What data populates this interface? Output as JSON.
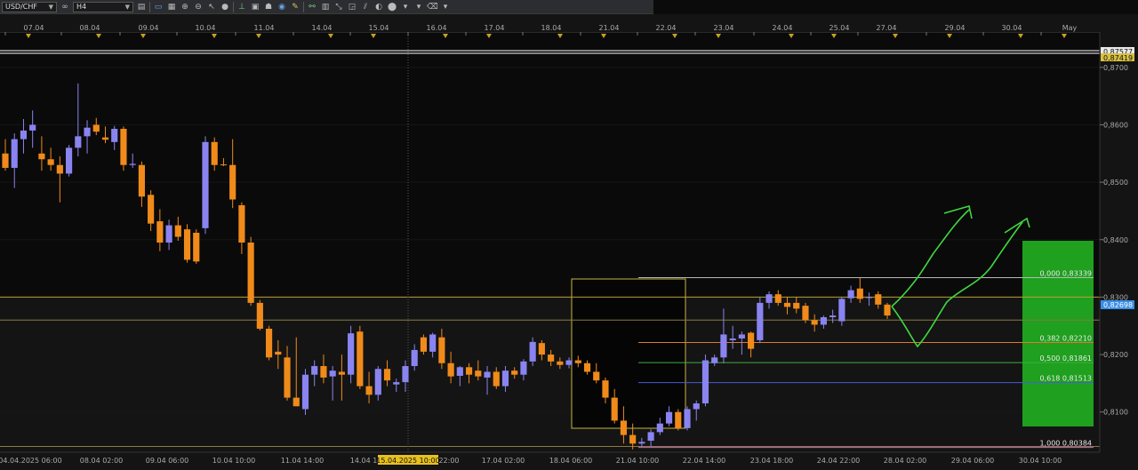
{
  "toolbar": {
    "symbol": "USD/CHF",
    "timeframe": "H4",
    "icons": [
      "chart-type-icon",
      "link-icon",
      "crosshair-icon",
      "zoom-in-icon",
      "zoom-out-icon",
      "cursor-icon",
      "point-icon",
      "trendline-icon",
      "text-icon",
      "object-icon",
      "screenshot-icon",
      "pencil-icon",
      "indicator-icon",
      "template-icon",
      "fibonacci-icon",
      "rectangle-icon",
      "channel-icon",
      "ellipse-icon",
      "line-icon",
      "eraser-icon"
    ]
  },
  "chart_data": {
    "type": "candlestick",
    "symbol": "USD/CHF",
    "timeframe": "H4",
    "y_range": [
      0.803,
      0.876
    ],
    "price_ticks": [
      "0,8700",
      "0,8600",
      "0,8500",
      "0,8400",
      "0,8300",
      "0,8200",
      "0,8100"
    ],
    "top_labels": [
      "07.04",
      "08.04",
      "09.04",
      "10.04",
      "11.04",
      "14.04",
      "15.04",
      "16.04",
      "17.04",
      "18.04",
      "21.04",
      "22.04",
      "23.04",
      "24.04",
      "25.04",
      "27.04",
      "29.04",
      "30.04",
      "May"
    ],
    "bottom_labels": [
      "04.04.2025 06:00",
      "08.04 02:00",
      "09.04 06:00",
      "10.04 10:00",
      "11.04 14:00",
      "14.04 18:00",
      "15.04.2025 10:00",
      "22:00",
      "17.04 02:00",
      "18.04 06:00",
      "21.04 10:00",
      "22.04 14:00",
      "23.04 18:00",
      "24.04 22:00",
      "28.04 02:00",
      "29.04 06:00",
      "30.04 10:00"
    ],
    "current_price": "0,82698",
    "top_price_labels": [
      "0,87577",
      "0,87419"
    ],
    "horizontal_levels": [
      0.83,
      0.826,
      0.804
    ],
    "fibonacci": [
      {
        "ratio": 0.0,
        "label": "0,000 0,83339",
        "price": 0.83339,
        "color": "#b8b8b8"
      },
      {
        "ratio": 0.382,
        "label": "0,382 0,82210",
        "price": 0.8221,
        "color": "#e07a2a"
      },
      {
        "ratio": 0.5,
        "label": "0,500 0,81861",
        "price": 0.81861,
        "color": "#3fae3f"
      },
      {
        "ratio": 0.618,
        "label": "0,618 0,81513",
        "price": 0.81513,
        "color": "#4a5bd6"
      },
      {
        "ratio": 1.0,
        "label": "1,000 0,80384",
        "price": 0.80384,
        "color": "#c070c0"
      }
    ],
    "candles": [
      {
        "o": 0.855,
        "h": 0.8575,
        "l": 0.852,
        "c": 0.8525
      },
      {
        "o": 0.8525,
        "h": 0.8585,
        "l": 0.849,
        "c": 0.8575
      },
      {
        "o": 0.8575,
        "h": 0.861,
        "l": 0.855,
        "c": 0.859
      },
      {
        "o": 0.859,
        "h": 0.8625,
        "l": 0.856,
        "c": 0.86
      },
      {
        "o": 0.855,
        "h": 0.858,
        "l": 0.852,
        "c": 0.854
      },
      {
        "o": 0.854,
        "h": 0.856,
        "l": 0.852,
        "c": 0.853
      },
      {
        "o": 0.853,
        "h": 0.8545,
        "l": 0.8465,
        "c": 0.8515
      },
      {
        "o": 0.8515,
        "h": 0.8565,
        "l": 0.851,
        "c": 0.856
      },
      {
        "o": 0.856,
        "h": 0.8672,
        "l": 0.8545,
        "c": 0.858
      },
      {
        "o": 0.858,
        "h": 0.8608,
        "l": 0.855,
        "c": 0.8595
      },
      {
        "o": 0.86,
        "h": 0.8612,
        "l": 0.8582,
        "c": 0.8588
      },
      {
        "o": 0.8578,
        "h": 0.8597,
        "l": 0.8568,
        "c": 0.8574
      },
      {
        "o": 0.857,
        "h": 0.8598,
        "l": 0.8556,
        "c": 0.8593
      },
      {
        "o": 0.8593,
        "h": 0.8597,
        "l": 0.852,
        "c": 0.853
      },
      {
        "o": 0.853,
        "h": 0.855,
        "l": 0.8525,
        "c": 0.8532
      },
      {
        "o": 0.853,
        "h": 0.8536,
        "l": 0.8457,
        "c": 0.8475
      },
      {
        "o": 0.8478,
        "h": 0.8486,
        "l": 0.8415,
        "c": 0.8428
      },
      {
        "o": 0.8432,
        "h": 0.8453,
        "l": 0.838,
        "c": 0.8395
      },
      {
        "o": 0.8395,
        "h": 0.8435,
        "l": 0.8382,
        "c": 0.8425
      },
      {
        "o": 0.8425,
        "h": 0.844,
        "l": 0.8398,
        "c": 0.8405
      },
      {
        "o": 0.8418,
        "h": 0.8427,
        "l": 0.836,
        "c": 0.8365
      },
      {
        "o": 0.8412,
        "h": 0.8418,
        "l": 0.8358,
        "c": 0.8362
      },
      {
        "o": 0.842,
        "h": 0.858,
        "l": 0.841,
        "c": 0.857
      },
      {
        "o": 0.857,
        "h": 0.8578,
        "l": 0.852,
        "c": 0.853
      },
      {
        "o": 0.8531,
        "h": 0.8542,
        "l": 0.8528,
        "c": 0.853
      },
      {
        "o": 0.853,
        "h": 0.8575,
        "l": 0.8455,
        "c": 0.847
      },
      {
        "o": 0.846,
        "h": 0.8465,
        "l": 0.8375,
        "c": 0.8395
      },
      {
        "o": 0.8395,
        "h": 0.8405,
        "l": 0.8285,
        "c": 0.829
      },
      {
        "o": 0.829,
        "h": 0.8295,
        "l": 0.8242,
        "c": 0.8245
      },
      {
        "o": 0.8245,
        "h": 0.825,
        "l": 0.819,
        "c": 0.8195
      },
      {
        "o": 0.8205,
        "h": 0.8225,
        "l": 0.8175,
        "c": 0.82
      },
      {
        "o": 0.8195,
        "h": 0.8215,
        "l": 0.812,
        "c": 0.8125
      },
      {
        "o": 0.8125,
        "h": 0.823,
        "l": 0.811,
        "c": 0.811
      },
      {
        "o": 0.8105,
        "h": 0.8175,
        "l": 0.8095,
        "c": 0.8165
      },
      {
        "o": 0.8165,
        "h": 0.819,
        "l": 0.8145,
        "c": 0.818
      },
      {
        "o": 0.818,
        "h": 0.82,
        "l": 0.815,
        "c": 0.816
      },
      {
        "o": 0.8162,
        "h": 0.818,
        "l": 0.812,
        "c": 0.8172
      },
      {
        "o": 0.817,
        "h": 0.82,
        "l": 0.812,
        "c": 0.8165
      },
      {
        "o": 0.8165,
        "h": 0.825,
        "l": 0.815,
        "c": 0.8237
      },
      {
        "o": 0.824,
        "h": 0.825,
        "l": 0.814,
        "c": 0.8145
      },
      {
        "o": 0.8145,
        "h": 0.817,
        "l": 0.8115,
        "c": 0.813
      },
      {
        "o": 0.813,
        "h": 0.818,
        "l": 0.812,
        "c": 0.8175
      },
      {
        "o": 0.8175,
        "h": 0.819,
        "l": 0.8145,
        "c": 0.8155
      },
      {
        "o": 0.8148,
        "h": 0.8158,
        "l": 0.8135,
        "c": 0.8152
      },
      {
        "o": 0.8152,
        "h": 0.819,
        "l": 0.8135,
        "c": 0.818
      },
      {
        "o": 0.818,
        "h": 0.8218,
        "l": 0.8172,
        "c": 0.8208
      },
      {
        "o": 0.823,
        "h": 0.8235,
        "l": 0.82,
        "c": 0.8205
      },
      {
        "o": 0.8205,
        "h": 0.8238,
        "l": 0.8195,
        "c": 0.8235
      },
      {
        "o": 0.823,
        "h": 0.8245,
        "l": 0.8175,
        "c": 0.8185
      },
      {
        "o": 0.8185,
        "h": 0.8205,
        "l": 0.815,
        "c": 0.8162
      },
      {
        "o": 0.8163,
        "h": 0.818,
        "l": 0.8145,
        "c": 0.8178
      },
      {
        "o": 0.8178,
        "h": 0.8185,
        "l": 0.815,
        "c": 0.8165
      },
      {
        "o": 0.8172,
        "h": 0.819,
        "l": 0.8155,
        "c": 0.8162
      },
      {
        "o": 0.816,
        "h": 0.818,
        "l": 0.813,
        "c": 0.817
      },
      {
        "o": 0.817,
        "h": 0.8178,
        "l": 0.814,
        "c": 0.8145
      },
      {
        "o": 0.8145,
        "h": 0.818,
        "l": 0.8135,
        "c": 0.8172
      },
      {
        "o": 0.8172,
        "h": 0.8178,
        "l": 0.8158,
        "c": 0.8165
      },
      {
        "o": 0.8165,
        "h": 0.8192,
        "l": 0.8155,
        "c": 0.8188
      },
      {
        "o": 0.8188,
        "h": 0.823,
        "l": 0.818,
        "c": 0.8222
      },
      {
        "o": 0.822,
        "h": 0.8225,
        "l": 0.819,
        "c": 0.82
      },
      {
        "o": 0.82,
        "h": 0.8208,
        "l": 0.818,
        "c": 0.8188
      },
      {
        "o": 0.8188,
        "h": 0.8195,
        "l": 0.8175,
        "c": 0.8182
      },
      {
        "o": 0.8182,
        "h": 0.8195,
        "l": 0.8176,
        "c": 0.819
      },
      {
        "o": 0.819,
        "h": 0.8198,
        "l": 0.8178,
        "c": 0.8185
      },
      {
        "o": 0.8185,
        "h": 0.819,
        "l": 0.8165,
        "c": 0.817
      },
      {
        "o": 0.817,
        "h": 0.8185,
        "l": 0.815,
        "c": 0.8155
      },
      {
        "o": 0.8155,
        "h": 0.816,
        "l": 0.8115,
        "c": 0.8125
      },
      {
        "o": 0.8125,
        "h": 0.814,
        "l": 0.808,
        "c": 0.8085
      },
      {
        "o": 0.8085,
        "h": 0.811,
        "l": 0.8045,
        "c": 0.806
      },
      {
        "o": 0.806,
        "h": 0.808,
        "l": 0.8035,
        "c": 0.8045
      },
      {
        "o": 0.8045,
        "h": 0.8055,
        "l": 0.804,
        "c": 0.8048
      },
      {
        "o": 0.805,
        "h": 0.807,
        "l": 0.804,
        "c": 0.8065
      },
      {
        "o": 0.8065,
        "h": 0.809,
        "l": 0.806,
        "c": 0.808
      },
      {
        "o": 0.808,
        "h": 0.811,
        "l": 0.8075,
        "c": 0.81
      },
      {
        "o": 0.81,
        "h": 0.8105,
        "l": 0.8068,
        "c": 0.8072
      },
      {
        "o": 0.8072,
        "h": 0.811,
        "l": 0.8068,
        "c": 0.8105
      },
      {
        "o": 0.8105,
        "h": 0.812,
        "l": 0.8085,
        "c": 0.8115
      },
      {
        "o": 0.8115,
        "h": 0.82,
        "l": 0.811,
        "c": 0.819
      },
      {
        "o": 0.8185,
        "h": 0.82,
        "l": 0.818,
        "c": 0.8195
      },
      {
        "o": 0.8195,
        "h": 0.828,
        "l": 0.8185,
        "c": 0.8235
      },
      {
        "o": 0.8225,
        "h": 0.825,
        "l": 0.821,
        "c": 0.8228
      },
      {
        "o": 0.8228,
        "h": 0.824,
        "l": 0.82,
        "c": 0.8235
      },
      {
        "o": 0.8238,
        "h": 0.824,
        "l": 0.8195,
        "c": 0.821
      },
      {
        "o": 0.8225,
        "h": 0.83,
        "l": 0.822,
        "c": 0.829
      },
      {
        "o": 0.829,
        "h": 0.831,
        "l": 0.828,
        "c": 0.8305
      },
      {
        "o": 0.8305,
        "h": 0.8312,
        "l": 0.8285,
        "c": 0.829
      },
      {
        "o": 0.829,
        "h": 0.83,
        "l": 0.827,
        "c": 0.8283
      },
      {
        "o": 0.829,
        "h": 0.83,
        "l": 0.8272,
        "c": 0.828
      },
      {
        "o": 0.8285,
        "h": 0.829,
        "l": 0.8255,
        "c": 0.826
      },
      {
        "o": 0.826,
        "h": 0.827,
        "l": 0.824,
        "c": 0.8252
      },
      {
        "o": 0.8252,
        "h": 0.8268,
        "l": 0.8245,
        "c": 0.8265
      },
      {
        "o": 0.8265,
        "h": 0.8278,
        "l": 0.8255,
        "c": 0.8268
      },
      {
        "o": 0.8258,
        "h": 0.83,
        "l": 0.825,
        "c": 0.8297
      },
      {
        "o": 0.8298,
        "h": 0.832,
        "l": 0.829,
        "c": 0.8312
      },
      {
        "o": 0.8315,
        "h": 0.8334,
        "l": 0.829,
        "c": 0.8297
      },
      {
        "o": 0.83,
        "h": 0.8308,
        "l": 0.8285,
        "c": 0.83
      },
      {
        "o": 0.8305,
        "h": 0.831,
        "l": 0.828,
        "c": 0.8287
      },
      {
        "o": 0.8287,
        "h": 0.829,
        "l": 0.8262,
        "c": 0.8268
      }
    ]
  }
}
